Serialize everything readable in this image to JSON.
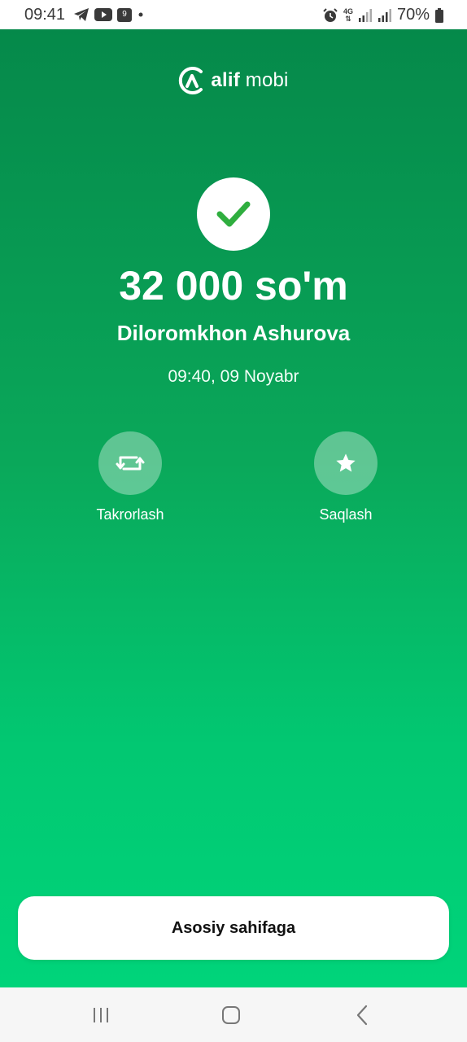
{
  "status_bar": {
    "time": "09:41",
    "left_icons": [
      "telegram-icon",
      "youtube-icon",
      "calendar-icon",
      "dot-icon"
    ],
    "calendar_badge": "9",
    "right_icons": [
      "alarm-icon",
      "4g-icon",
      "signal-icon",
      "signal-icon",
      "battery-icon"
    ],
    "network_label": "4G",
    "battery": "70%"
  },
  "brand": {
    "name_bold": "alif",
    "name_regular": "mobi"
  },
  "payment": {
    "status_icon": "check-icon",
    "amount": "32 000 so'm",
    "recipient": "Diloromkhon Ashurova",
    "datetime": "09:40, 09 Noyabr"
  },
  "actions": [
    {
      "label": "Takrorlash",
      "icon": "repeat-icon"
    },
    {
      "label": "Saqlash",
      "icon": "star-icon"
    }
  ],
  "home_button": {
    "label": "Asosiy sahifaga"
  },
  "nav_bar": {
    "items": [
      "recent-apps-icon",
      "home-icon",
      "back-icon"
    ]
  },
  "colors": {
    "gradient_top": "#05894a",
    "gradient_bottom": "#00d47a",
    "check": "#2fae3f"
  }
}
